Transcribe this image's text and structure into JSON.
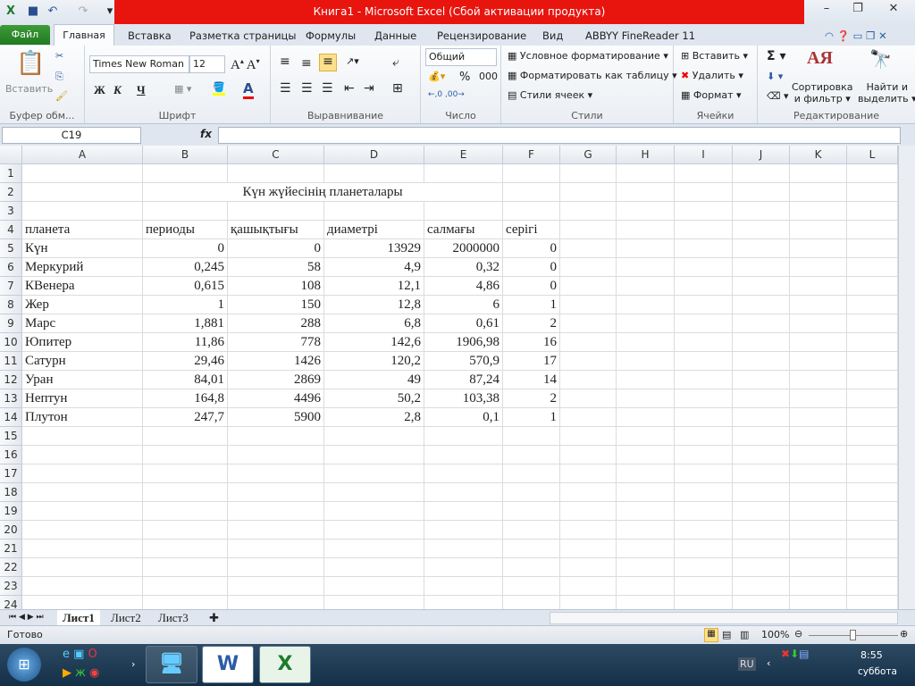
{
  "window": {
    "title": "Книга1  -  Microsoft Excel (Сбой активации продукта)"
  },
  "tabs": [
    "Файл",
    "Главная",
    "Вставка",
    "Разметка страницы",
    "Формулы",
    "Данные",
    "Рецензирование",
    "Вид",
    "ABBYY FineReader 11"
  ],
  "ribbon": {
    "clipboard": {
      "paste": "Вставить",
      "label": "Буфер обм..."
    },
    "font": {
      "name": "Times New Roman",
      "size": "12",
      "bold": "Ж",
      "italic": "К",
      "underline": "Ч",
      "label": "Шрифт"
    },
    "alignment": {
      "label": "Выравнивание"
    },
    "number": {
      "format": "Общий",
      "percent": "%",
      "thousands": "000",
      "label": "Число"
    },
    "styles": {
      "conditional": "Условное форматирование",
      "as_table": "Форматировать как таблицу",
      "cell_styles": "Стили ячеек",
      "label": "Стили"
    },
    "cells": {
      "insert": "Вставить",
      "delete": "Удалить",
      "format": "Формат",
      "label": "Ячейки"
    },
    "editing": {
      "sort1": "Сортировка",
      "sort2": "и фильтр",
      "find1": "Найти и",
      "find2": "выделить",
      "label": "Редактирование"
    }
  },
  "formula_bar": {
    "name_box": "C19",
    "fx": "fx",
    "value": ""
  },
  "columns": [
    "A",
    "B",
    "C",
    "D",
    "E",
    "F",
    "G",
    "H",
    "I",
    "J",
    "K",
    "L"
  ],
  "sheet": {
    "title": "Күн жүйесінің планеталары",
    "headers": [
      "планета",
      "периоды",
      "қашықтығы",
      "диаметрі",
      "салмағы",
      "серігі"
    ],
    "rows": [
      [
        "Күн",
        "0",
        "0",
        "13929",
        "2000000",
        "0"
      ],
      [
        "Меркурий",
        "0,245",
        "58",
        "4,9",
        "0,32",
        "0"
      ],
      [
        "КВенера",
        "0,615",
        "108",
        "12,1",
        "4,86",
        "0"
      ],
      [
        "Жер",
        "1",
        "150",
        "12,8",
        "6",
        "1"
      ],
      [
        "Марс",
        "1,881",
        "288",
        "6,8",
        "0,61",
        "2"
      ],
      [
        "Юпитер",
        "11,86",
        "778",
        "142,6",
        "1906,98",
        "16"
      ],
      [
        "Сатурн",
        "29,46",
        "1426",
        "120,2",
        "570,9",
        "17"
      ],
      [
        "Уран",
        "84,01",
        "2869",
        "49",
        "87,24",
        "14"
      ],
      [
        "Нептун",
        "164,8",
        "4496",
        "50,2",
        "103,38",
        "2"
      ],
      [
        "Плутон",
        "247,7",
        "5900",
        "2,8",
        "0,1",
        "1"
      ]
    ]
  },
  "sheet_tabs": [
    "Лист1",
    "Лист2",
    "Лист3"
  ],
  "status": {
    "ready": "Готово",
    "zoom": "100%"
  },
  "taskbar": {
    "lang": "RU",
    "time": "8:55",
    "day": "суббота"
  }
}
